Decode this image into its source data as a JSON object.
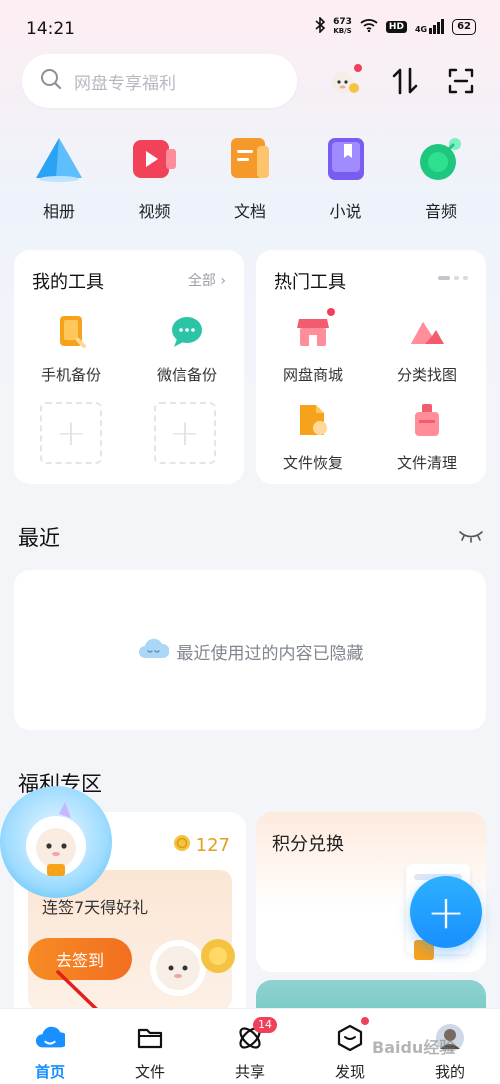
{
  "status_bar": {
    "time": "14:21",
    "net_speed": "673",
    "net_unit": "KB/S",
    "hd": "HD",
    "signal": "4G",
    "battery": "62"
  },
  "search": {
    "placeholder": "网盘专享福利"
  },
  "categories": [
    {
      "label": "相册",
      "icon": "photo-album-icon",
      "color": "#2aa3f5"
    },
    {
      "label": "视频",
      "icon": "video-icon",
      "color": "#f2425a"
    },
    {
      "label": "文档",
      "icon": "document-icon",
      "color": "#f59a2a"
    },
    {
      "label": "小说",
      "icon": "novel-icon",
      "color": "#7a5cf0"
    },
    {
      "label": "音频",
      "icon": "audio-icon",
      "color": "#1fc77e"
    }
  ],
  "my_tools": {
    "title": "我的工具",
    "more": "全部",
    "items": [
      {
        "label": "手机备份",
        "icon": "phone-backup-icon"
      },
      {
        "label": "微信备份",
        "icon": "wechat-backup-icon"
      }
    ]
  },
  "hot_tools": {
    "title": "热门工具",
    "items": [
      {
        "label": "网盘商城",
        "icon": "store-icon"
      },
      {
        "label": "分类找图",
        "icon": "find-image-icon"
      },
      {
        "label": "文件恢复",
        "icon": "file-recovery-icon"
      },
      {
        "label": "文件清理",
        "icon": "file-cleanup-icon"
      }
    ]
  },
  "recent": {
    "title": "最近",
    "empty_text": "最近使用过的内容已隐藏"
  },
  "welfare": {
    "title": "福利专区",
    "sign_card_title_tail": "分",
    "coins": "127",
    "sign_desc": "连签7天得好礼",
    "sign_button": "去签到",
    "exchange_title": "积分兑换"
  },
  "bottom_nav": [
    {
      "label": "首页",
      "icon": "home-cloud-icon",
      "active": true
    },
    {
      "label": "文件",
      "icon": "folder-icon"
    },
    {
      "label": "共享",
      "icon": "share-icon",
      "badge": "14"
    },
    {
      "label": "发现",
      "icon": "discover-icon"
    },
    {
      "label": "我的",
      "icon": "profile-avatar-icon"
    }
  ],
  "watermark": "Baidu经验",
  "colors": {
    "accent": "#1890ff",
    "orange": "#f78b25",
    "badge_red": "#f0405a"
  }
}
